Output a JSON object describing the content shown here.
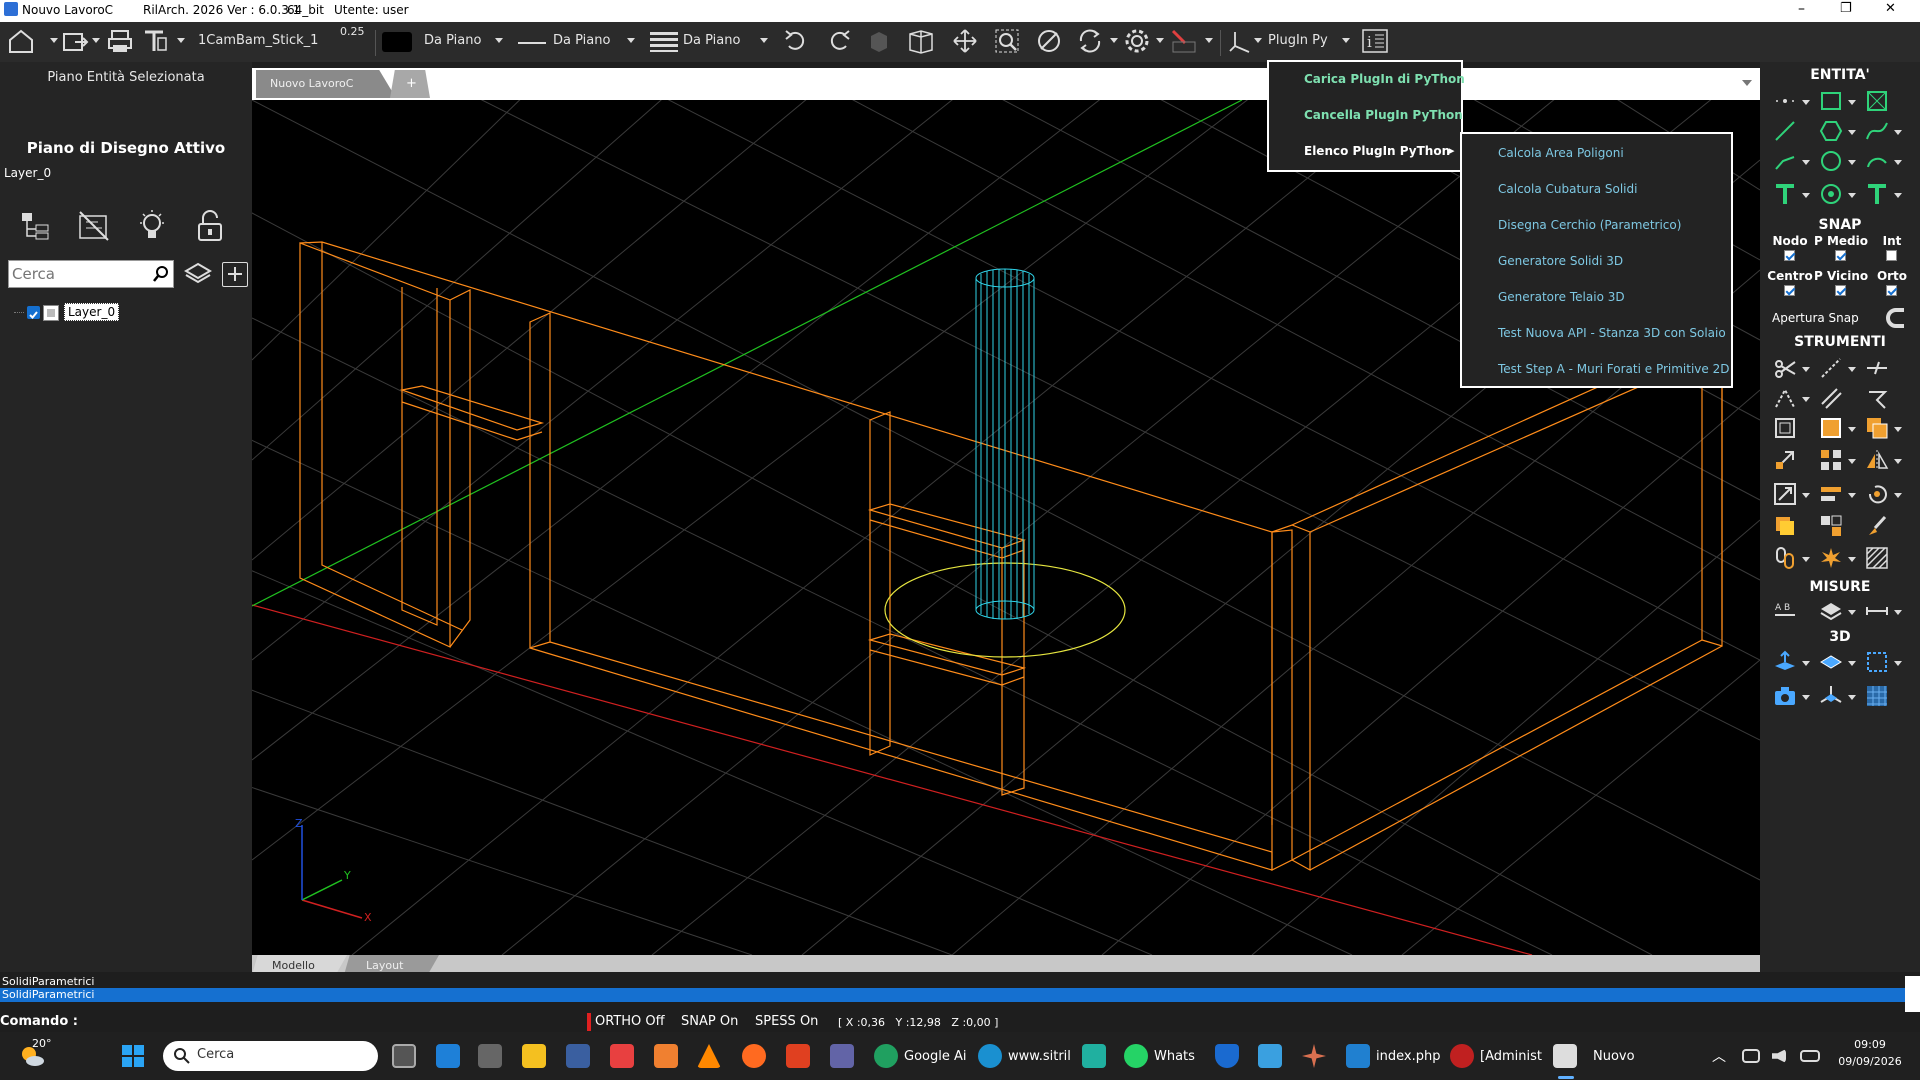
{
  "titlebar": {
    "doc_title": "Nouvo LavoroC",
    "app_version": "RilArch. 2026 Ver : 6.0.3.1",
    "arch": "64_bit",
    "user": "Utente: user",
    "min": "–",
    "max": "❐",
    "close": "✕"
  },
  "toolbar": {
    "layer_name": "1CamBam_Stick_1",
    "line_width": "0.25",
    "color_label": "Da Piano",
    "linetype_label": "Da Piano",
    "lineweight_label": "Da Piano",
    "plugin_label": "PlugIn Py"
  },
  "left_panel": {
    "selected_entity_plane": "Piano Entità Selezionata",
    "active_plane_title": "Piano di Disegno Attivo",
    "active_layer": "Layer_0",
    "search_placeholder": "Cerca",
    "layers": [
      {
        "name": "Layer_0",
        "visible": true
      }
    ]
  },
  "view_tabs": {
    "tabs": [
      "Nuovo LavoroC"
    ],
    "add": "+"
  },
  "bottom_tabs": [
    "Modello",
    "Layout"
  ],
  "axes": {
    "x": "X",
    "y": "Y",
    "z": "Z"
  },
  "plugin_menu": {
    "items": [
      "Carica PlugIn di PyThon",
      "Cancella PlugIn PyThon",
      "Elenco PlugIn PyThon"
    ],
    "submenu_arrow": "▸",
    "submenu": [
      "Calcola Area Poligoni",
      "Calcola Cubatura Solidi",
      "Disegna Cerchio (Parametrico)",
      "Generatore Solidi 3D",
      "Generatore Telaio 3D",
      "Test Nuova API - Stanza 3D con Solaio",
      "Test Step A - Muri Forati e Primitive 2D"
    ]
  },
  "right_panel": {
    "entita": "ENTITA'",
    "snap": "SNAP",
    "snap_options": [
      {
        "label": "Nodo",
        "checked": true
      },
      {
        "label": "P Medio",
        "checked": true
      },
      {
        "label": "Int",
        "checked": false
      },
      {
        "label": "Centro",
        "checked": true
      },
      {
        "label": "P Vicino",
        "checked": true
      },
      {
        "label": "Orto",
        "checked": true
      }
    ],
    "apertura_snap": "Apertura Snap",
    "strumenti": "STRUMENTI",
    "misure": "MISURE",
    "three_d": "3D"
  },
  "command": {
    "history": [
      "SolidiParametrici"
    ],
    "current": "SolidiParametrici",
    "prompt": "Comando :",
    "ortho": "ORTHO Off",
    "snap": "SNAP On",
    "spess": "SPESS On",
    "coords": "[ X :0,36   Y :12,98   Z :0,00 ]"
  },
  "taskbar": {
    "weather": "20°",
    "search": "Cerca",
    "apps": [
      "Google Ai",
      "www.sitril",
      "Whats",
      "index.php",
      "[Administ",
      "Nuovo"
    ],
    "time": "09:09",
    "date": "09/09/2026"
  },
  "colors": {
    "accent": "#1570d0",
    "orange": "#ff8c1a",
    "cyan": "#2fd3e8",
    "yellow": "#e6e640",
    "green": "#20c020",
    "red": "#d02020"
  }
}
